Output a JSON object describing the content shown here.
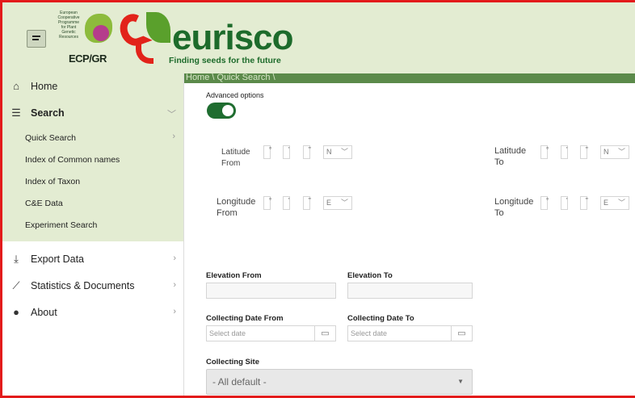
{
  "header": {
    "ecpgr_small_text": [
      "European",
      "Cooperative",
      "Programme",
      "for Plant",
      "Genetic",
      "Resources"
    ],
    "ecpgr_name": "ECP/GR",
    "app_title": "eurisco",
    "tagline": "Finding seeds for the future"
  },
  "breadcrumb": "Home \\ Quick Search \\",
  "sidebar": {
    "home": "Home",
    "search": "Search",
    "sub_items": [
      "Quick Search",
      "Index of Common names",
      "Index of Taxon",
      "C&E Data",
      "Experiment Search"
    ],
    "export": "Export Data",
    "stats": "Statistics & Documents",
    "about": "About"
  },
  "form": {
    "advanced_options": "Advanced options",
    "lat_from_line1": "Latitude",
    "lat_from_line2": "From",
    "lat_to_line1": "Latitude",
    "lat_to_line2": "To",
    "lon_from_line1": "Longitude",
    "lon_from_line2": "From",
    "lon_to_line1": "Longitude",
    "lon_to_line2": "To",
    "lat_dir": "N",
    "lat_to_dir": "N",
    "lon_dir": "E",
    "lon_to_dir": "E",
    "deg_symbol": "°",
    "min_symbol": "'",
    "sec_symbol": "\"",
    "elevation_from": "Elevation From",
    "elevation_to": "Elevation To",
    "collecting_date_from": "Collecting Date From",
    "collecting_date_to": "Collecting Date To",
    "date_placeholder": "Select date",
    "collecting_site": "Collecting Site",
    "collecting_site_value": "- All default -"
  },
  "colors": {
    "header_bg": "#e3ecd2",
    "brand_green": "#1d6b2b",
    "brand_red": "#e2231a",
    "toggle_on": "#1f6d30",
    "breadcrumb_bg": "#5b8a4a"
  }
}
